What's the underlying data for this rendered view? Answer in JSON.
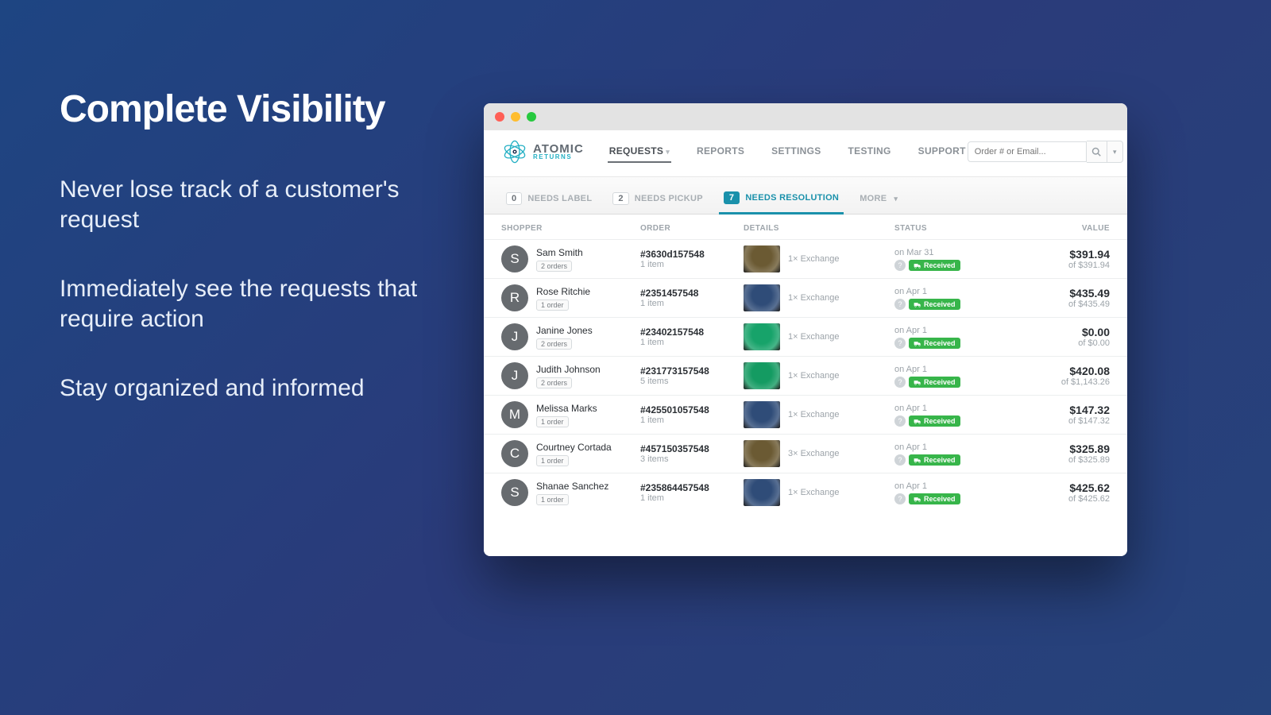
{
  "hero": {
    "title": "Complete Visibility",
    "p1": "Never lose track of a customer's request",
    "p2": "Immediately see the requests that require action",
    "p3": "Stay organized and informed"
  },
  "brand": {
    "name": "ATOMIC",
    "sub": "RETURNS"
  },
  "nav": {
    "requests": "REQUESTS",
    "reports": "REPORTS",
    "settings": "SETTINGS",
    "testing": "TESTING",
    "support": "SUPPORT"
  },
  "search": {
    "placeholder": "Order # or Email..."
  },
  "tabs": {
    "label": {
      "count": "0",
      "text": "NEEDS LABEL"
    },
    "pickup": {
      "count": "2",
      "text": "NEEDS PICKUP"
    },
    "resolution": {
      "count": "7",
      "text": "NEEDS RESOLUTION"
    },
    "more": "MORE"
  },
  "columns": {
    "shopper": "SHOPPER",
    "order": "ORDER",
    "details": "DETAILS",
    "status": "STATUS",
    "value": "VALUE"
  },
  "status_label": "Received",
  "rows": [
    {
      "initial": "S",
      "name": "Sam Smith",
      "orders": "2 orders",
      "order_num": "#3630d157548",
      "items": "1 item",
      "thumb": "#6b5a33",
      "detail": "1× Exchange",
      "date": "on Mar 31",
      "value": "$391.94",
      "sub": "of $391.94"
    },
    {
      "initial": "R",
      "name": "Rose Ritchie",
      "orders": "1 order",
      "order_num": "#2351457548",
      "items": "1 item",
      "thumb": "#2f4c78",
      "detail": "1× Exchange",
      "date": "on Apr 1",
      "value": "$435.49",
      "sub": "of $435.49"
    },
    {
      "initial": "J",
      "name": "Janine Jones",
      "orders": "2 orders",
      "order_num": "#23402157548",
      "items": "1 item",
      "thumb": "#17a36a",
      "detail": "1× Exchange",
      "date": "on Apr 1",
      "value": "$0.00",
      "sub": "of $0.00"
    },
    {
      "initial": "J",
      "name": "Judith Johnson",
      "orders": "2 orders",
      "order_num": "#231773157548",
      "items": "5 items",
      "thumb": "#149b62",
      "detail": "1× Exchange",
      "date": "on Apr 1",
      "value": "$420.08",
      "sub": "of $1,143.26"
    },
    {
      "initial": "M",
      "name": "Melissa Marks",
      "orders": "1 order",
      "order_num": "#425501057548",
      "items": "1 item",
      "thumb": "#2f4c78",
      "detail": "1× Exchange",
      "date": "on Apr 1",
      "value": "$147.32",
      "sub": "of $147.32"
    },
    {
      "initial": "C",
      "name": "Courtney Cortada",
      "orders": "1 order",
      "order_num": "#457150357548",
      "items": "3 items",
      "thumb": "#6b5a33",
      "detail": "3× Exchange",
      "date": "on Apr 1",
      "value": "$325.89",
      "sub": "of $325.89"
    },
    {
      "initial": "S",
      "name": "Shanae Sanchez",
      "orders": "1 order",
      "order_num": "#235864457548",
      "items": "1 item",
      "thumb": "#2f4c78",
      "detail": "1× Exchange",
      "date": "on Apr 1",
      "value": "$425.62",
      "sub": "of $425.62"
    }
  ]
}
